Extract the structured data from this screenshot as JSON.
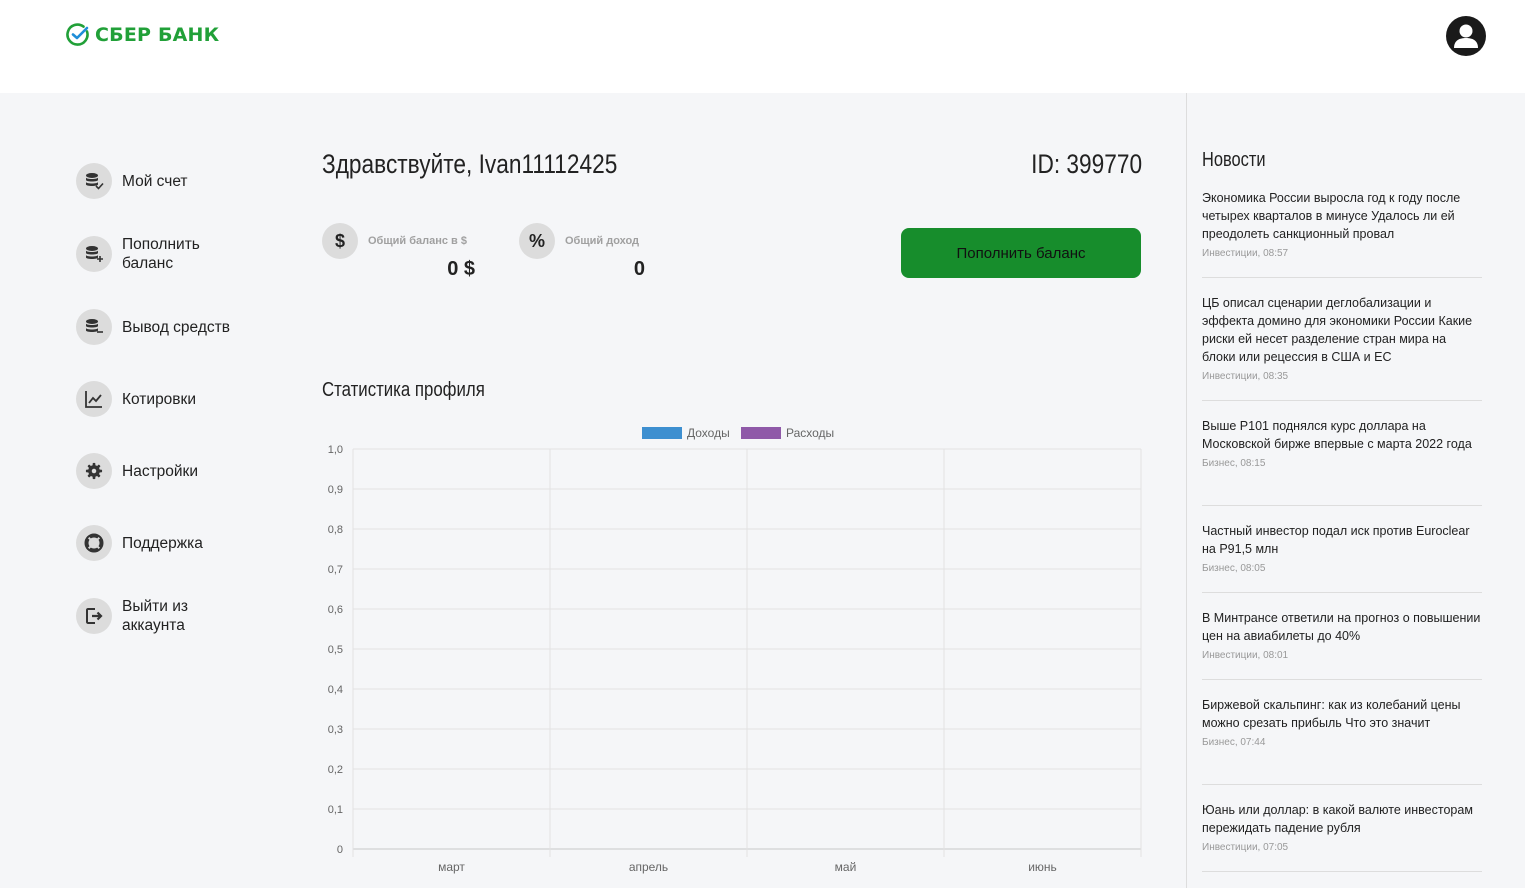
{
  "header": {
    "logo_text": "СБЕР БАНК"
  },
  "sidebar": {
    "items": [
      {
        "label": "Мой счет",
        "icon": "coins-check-icon"
      },
      {
        "label": "Пополнить баланс",
        "icon": "coins-plus-icon"
      },
      {
        "label": "Вывод средств",
        "icon": "coins-minus-icon"
      },
      {
        "label": "Котировки",
        "icon": "chart-line-icon"
      },
      {
        "label": "Настройки",
        "icon": "gear-icon"
      },
      {
        "label": "Поддержка",
        "icon": "lifebuoy-icon"
      },
      {
        "label": "Выйти из аккаунта",
        "icon": "logout-icon"
      }
    ]
  },
  "main": {
    "greeting": "Здравствуйте, Ivan11112425",
    "user_id": "ID: 399770",
    "balance": {
      "symbol": "$",
      "label": "Общий баланс в $",
      "value": "0 $"
    },
    "income": {
      "symbol": "%",
      "label": "Общий доход",
      "value": "0"
    },
    "topup_button": "Пополнить баланс",
    "stats_title": "Статистика профиля"
  },
  "chart_data": {
    "type": "bar",
    "categories": [
      "март",
      "апрель",
      "май",
      "июнь"
    ],
    "series": [
      {
        "name": "Доходы",
        "values": [
          0,
          0,
          0,
          0
        ],
        "color": "#3d8fd0"
      },
      {
        "name": "Расходы",
        "values": [
          0,
          0,
          0,
          0
        ],
        "color": "#8f59a8"
      }
    ],
    "y_ticks": [
      "0",
      "0,1",
      "0,2",
      "0,3",
      "0,4",
      "0,5",
      "0,6",
      "0,7",
      "0,8",
      "0,9",
      "1,0"
    ],
    "ylim": [
      0,
      1
    ],
    "legend": "top-center",
    "grid": true
  },
  "news": {
    "title": "Новости",
    "items": [
      {
        "text": "Экономика России выросла год к году после четырех кварталов в минусе Удалось ли ей преодолеть санкционный провал",
        "meta": "Инвестиции, 08:57"
      },
      {
        "text": "ЦБ описал сценарии деглобализации и эффекта домино для экономики России Какие риски ей несет разделение стран мира на блоки или рецессия в США и ЕС",
        "meta": "Инвестиции, 08:35"
      },
      {
        "text": "Выше Р101 поднялся курс доллара на Московской бирже впервые с марта 2022 года",
        "meta": "Бизнес, 08:15"
      },
      {
        "text": "Частный инвестор подал иск против Euroclear на Р91,5 млн",
        "meta": "Бизнес, 08:05"
      },
      {
        "text": "В Минтрансе ответили на прогноз о повышении цен на авиабилеты до 40%",
        "meta": "Инвестиции, 08:01"
      },
      {
        "text": "Биржевой скальпинг: как из колебаний цены можно срезать прибыль Что это значит",
        "meta": "Бизнес, 07:44"
      },
      {
        "text": "Юань или доллар: в какой валюте инвесторам пережидать падение рубля",
        "meta": "Инвестиции, 07:05"
      }
    ]
  }
}
